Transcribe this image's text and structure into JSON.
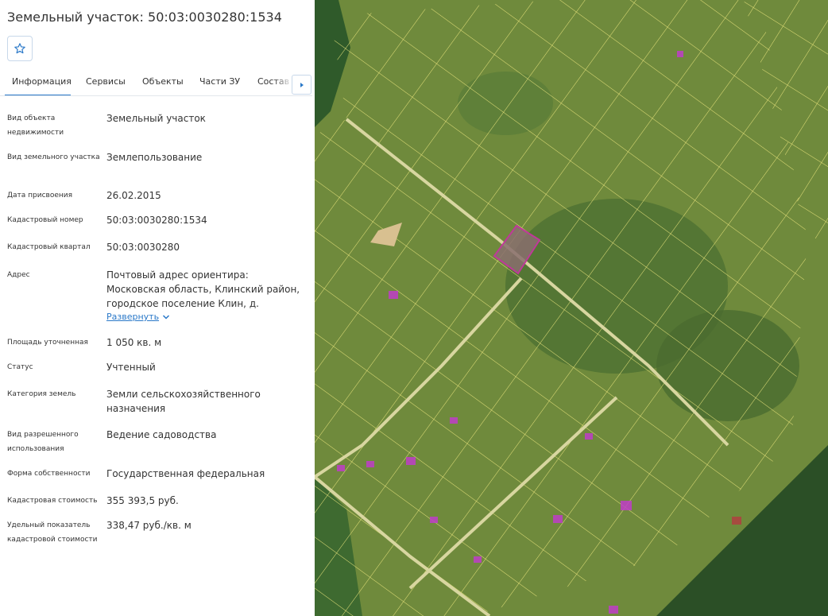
{
  "header": {
    "title": "Земельный участок: 50:03:0030280:1534"
  },
  "tabs": [
    {
      "label": "Информация"
    },
    {
      "label": "Сервисы"
    },
    {
      "label": "Объекты"
    },
    {
      "label": "Части ЗУ"
    },
    {
      "label": "Состав ЕЗП"
    }
  ],
  "fields": {
    "object_type": {
      "label": "Вид объекта недвижимости",
      "value": "Земельный участок"
    },
    "parcel_type": {
      "label": "Вид земельного участка",
      "value": "Землепользование"
    },
    "assign_date": {
      "label": "Дата присвоения",
      "value": "26.02.2015"
    },
    "cad_number": {
      "label": "Кадастровый номер",
      "value": "50:03:0030280:1534"
    },
    "cad_quarter": {
      "label": "Кадастровый квартал",
      "value": "50:03:0030280"
    },
    "address": {
      "label": "Адрес",
      "value": "Почтовый адрес ориентира: Московская область, Клинский район, городское поселение Клин, д.",
      "expand": "Развернуть"
    },
    "area": {
      "label": "Площадь уточненная",
      "value": "1 050 кв. м"
    },
    "status": {
      "label": "Статус",
      "value": "Учтенный"
    },
    "land_category": {
      "label": "Категория земель",
      "value": "Земли сельскохозяйственного назначения"
    },
    "permitted_use": {
      "label": "Вид разрешенного использования",
      "value": "Ведение садоводства"
    },
    "ownership": {
      "label": "Форма собственности",
      "value": "Государственная федеральная"
    },
    "cad_cost": {
      "label": "Кадастровая стоимость",
      "value": "355 393,5 руб."
    },
    "unit_cost": {
      "label": "Удельный показатель кадастровой стоимости",
      "value": "338,47 руб./кв. м"
    }
  },
  "icons": {
    "favorite": "star-icon",
    "scroll_tabs": "chevron-right-icon",
    "expand": "chevron-down-icon"
  },
  "colors": {
    "accent": "#2a78c8",
    "map_grid": "#e6e27a",
    "selected_parcel": "#c0389a",
    "building": "#c03cc8"
  }
}
